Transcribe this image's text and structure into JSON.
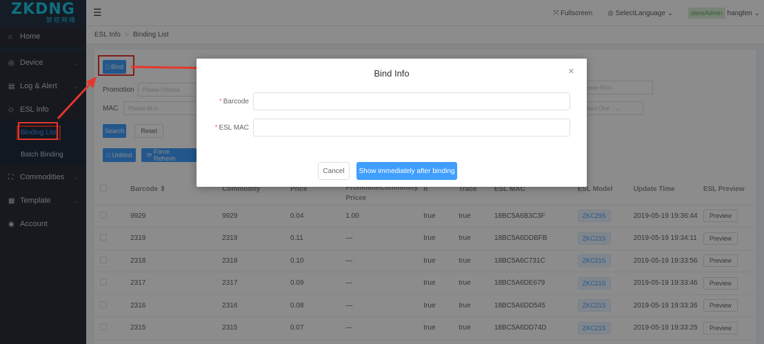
{
  "logo": {
    "main": "ZKDNG",
    "sub": "智控网络"
  },
  "sidebar": {
    "items": [
      {
        "icon": "⌂",
        "label": "Home"
      },
      {
        "icon": "◎",
        "label": "Device"
      },
      {
        "icon": "▤",
        "label": "Log & Alert"
      },
      {
        "icon": "◇",
        "label": "ESL Info"
      },
      {
        "icon": "⛶",
        "label": "Commodities"
      },
      {
        "icon": "▦",
        "label": "Template"
      },
      {
        "icon": "◉",
        "label": "Account"
      }
    ],
    "sub_items": [
      {
        "label": "Binding List"
      },
      {
        "label": "Batch Binding"
      }
    ]
  },
  "topbar": {
    "fullscreen": "Fullscreen",
    "language": "SelectLanguage",
    "user_badge": "storeAdmin",
    "user_name": "hangten"
  },
  "breadcrumb": {
    "first": "ESL Info",
    "second": "Binding List"
  },
  "toolbar": {
    "bind_label": "Bind",
    "search_label": "Search",
    "reset_label": "Reset",
    "unbind_label": "Unbind",
    "force_refresh_label": "Force Refresh"
  },
  "filters": {
    "promotion_label": "Promotion",
    "promotion_placeholder": "Please Choose",
    "mac_label": "MAC",
    "mac_placeholder": "Please fill in",
    "right_placeholder_1": "Please fill in",
    "right_placeholder_2": "Select One"
  },
  "table": {
    "headers": {
      "barcode": "Barcode ⇕",
      "commodity": "Commodity",
      "price": "Price",
      "promo_1": "el PromotionCommodity",
      "promo_2": "Pricee",
      "col_n": "n",
      "trace": "Trace",
      "esl_mac": "ESL MAC",
      "esl_model": "ESL Model",
      "update_time": "Update Time",
      "esl_preview": "ESL Preview"
    },
    "rows": [
      {
        "barcode": "9929",
        "commodity": "9929",
        "price": "0.04",
        "promo": "1.00",
        "n": "true",
        "trace": "true",
        "mac": "18BC5A6B3C3F",
        "model": "ZKC29S",
        "time": "2019-05-19 19:36:44",
        "preview": "Preview"
      },
      {
        "barcode": "2319",
        "commodity": "2319",
        "price": "0.11",
        "promo": "—",
        "n": "true",
        "trace": "true",
        "mac": "18BC5A6DDBFB",
        "model": "ZKC21S",
        "time": "2019-05-19 19:34:11",
        "preview": "Preview"
      },
      {
        "barcode": "2318",
        "commodity": "2318",
        "price": "0.10",
        "promo": "—",
        "n": "true",
        "trace": "true",
        "mac": "18BC5A6C731C",
        "model": "ZKC21S",
        "time": "2019-05-19 19:33:56",
        "preview": "Preview"
      },
      {
        "barcode": "2317",
        "commodity": "2317",
        "price": "0.09",
        "promo": "—",
        "n": "true",
        "trace": "true",
        "mac": "18BC5A6DE679",
        "model": "ZKC21S",
        "time": "2019-05-19 19:33:46",
        "preview": "Preview"
      },
      {
        "barcode": "2316",
        "commodity": "2316",
        "price": "0.08",
        "promo": "—",
        "n": "true",
        "trace": "true",
        "mac": "18BC5A6DD545",
        "model": "ZKC21S",
        "time": "2019-05-19 19:33:36",
        "preview": "Preview"
      },
      {
        "barcode": "2315",
        "commodity": "2315",
        "price": "0.07",
        "promo": "—",
        "n": "true",
        "trace": "true",
        "mac": "18BC5A6DD74D",
        "model": "ZKC21S",
        "time": "2019-05-19 19:33:25",
        "preview": "Preview"
      }
    ]
  },
  "dialog": {
    "title": "Bind Info",
    "barcode_label": "Barcode",
    "esl_mac_label": "ESL MAC",
    "barcode_value": "",
    "esl_mac_value": "",
    "cancel_label": "Cancel",
    "confirm_label": "Show immediately after binding"
  },
  "colors": {
    "primary": "#409eff",
    "sidebar": "#2b2f3a",
    "highlight": "#e8362b"
  }
}
